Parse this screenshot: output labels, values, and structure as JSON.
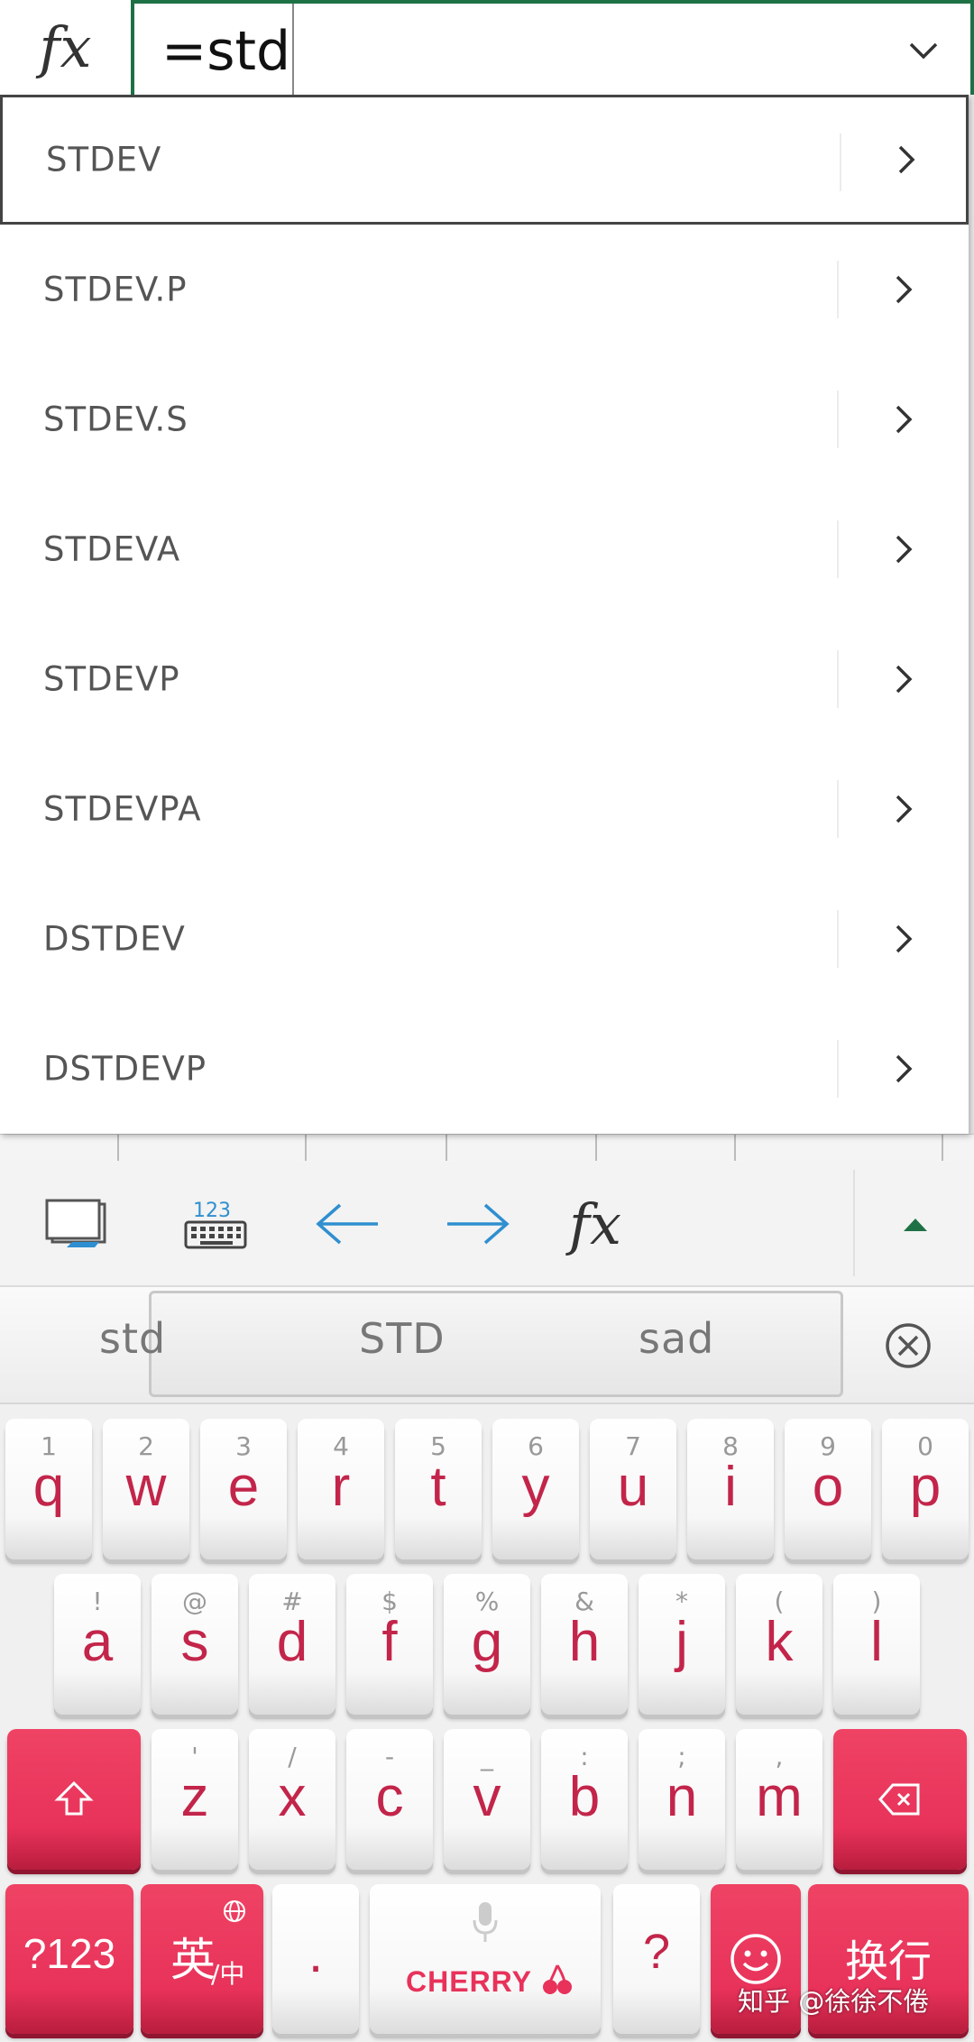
{
  "formula_bar": {
    "fx_label": "fx",
    "input_text": "=std",
    "expand_icon": "chevron-down-icon"
  },
  "suggestions": [
    {
      "label": "STDEV",
      "selected": true
    },
    {
      "label": "STDEV.P",
      "selected": false
    },
    {
      "label": "STDEV.S",
      "selected": false
    },
    {
      "label": "STDEVA",
      "selected": false
    },
    {
      "label": "STDEVP",
      "selected": false
    },
    {
      "label": "STDEVPA",
      "selected": false
    },
    {
      "label": "DSTDEV",
      "selected": false
    },
    {
      "label": "DSTDEVP",
      "selected": false
    }
  ],
  "accessory_bar": {
    "fx_label": "fx",
    "keypad_label": "123",
    "icons": [
      "keyboard-hide-icon",
      "numeric-keyboard-icon",
      "arrow-left-icon",
      "arrow-right-icon",
      "fx-icon",
      "expand-up-icon"
    ]
  },
  "candidates": [
    "std",
    "STD",
    "sad"
  ],
  "keyboard": {
    "row1": [
      {
        "sub": "1",
        "main": "q"
      },
      {
        "sub": "2",
        "main": "w"
      },
      {
        "sub": "3",
        "main": "e"
      },
      {
        "sub": "4",
        "main": "r"
      },
      {
        "sub": "5",
        "main": "t"
      },
      {
        "sub": "6",
        "main": "y"
      },
      {
        "sub": "7",
        "main": "u"
      },
      {
        "sub": "8",
        "main": "i"
      },
      {
        "sub": "9",
        "main": "o"
      },
      {
        "sub": "0",
        "main": "p"
      }
    ],
    "row2": [
      {
        "sub": "!",
        "main": "a"
      },
      {
        "sub": "@",
        "main": "s"
      },
      {
        "sub": "#",
        "main": "d"
      },
      {
        "sub": "$",
        "main": "f"
      },
      {
        "sub": "%",
        "main": "g"
      },
      {
        "sub": "&",
        "main": "h"
      },
      {
        "sub": "*",
        "main": "j"
      },
      {
        "sub": "(",
        "main": "k"
      },
      {
        "sub": ")",
        "main": "l"
      }
    ],
    "row3": [
      {
        "sub": "'",
        "main": "z"
      },
      {
        "sub": "/",
        "main": "x"
      },
      {
        "sub": "-",
        "main": "c"
      },
      {
        "sub": "_",
        "main": "v"
      },
      {
        "sub": ":",
        "main": "b"
      },
      {
        "sub": ";",
        "main": "n"
      },
      {
        "sub": ",",
        "main": "m"
      }
    ],
    "symbols_key": "?123",
    "lang_key_main": "英",
    "lang_key_sub": "/中",
    "period_key": ".",
    "space_brand": "CHERRY",
    "question_key": "?",
    "enter_key": "换行",
    "accent_color": "#e8325a"
  },
  "watermark": "知乎 @徐徐不倦"
}
